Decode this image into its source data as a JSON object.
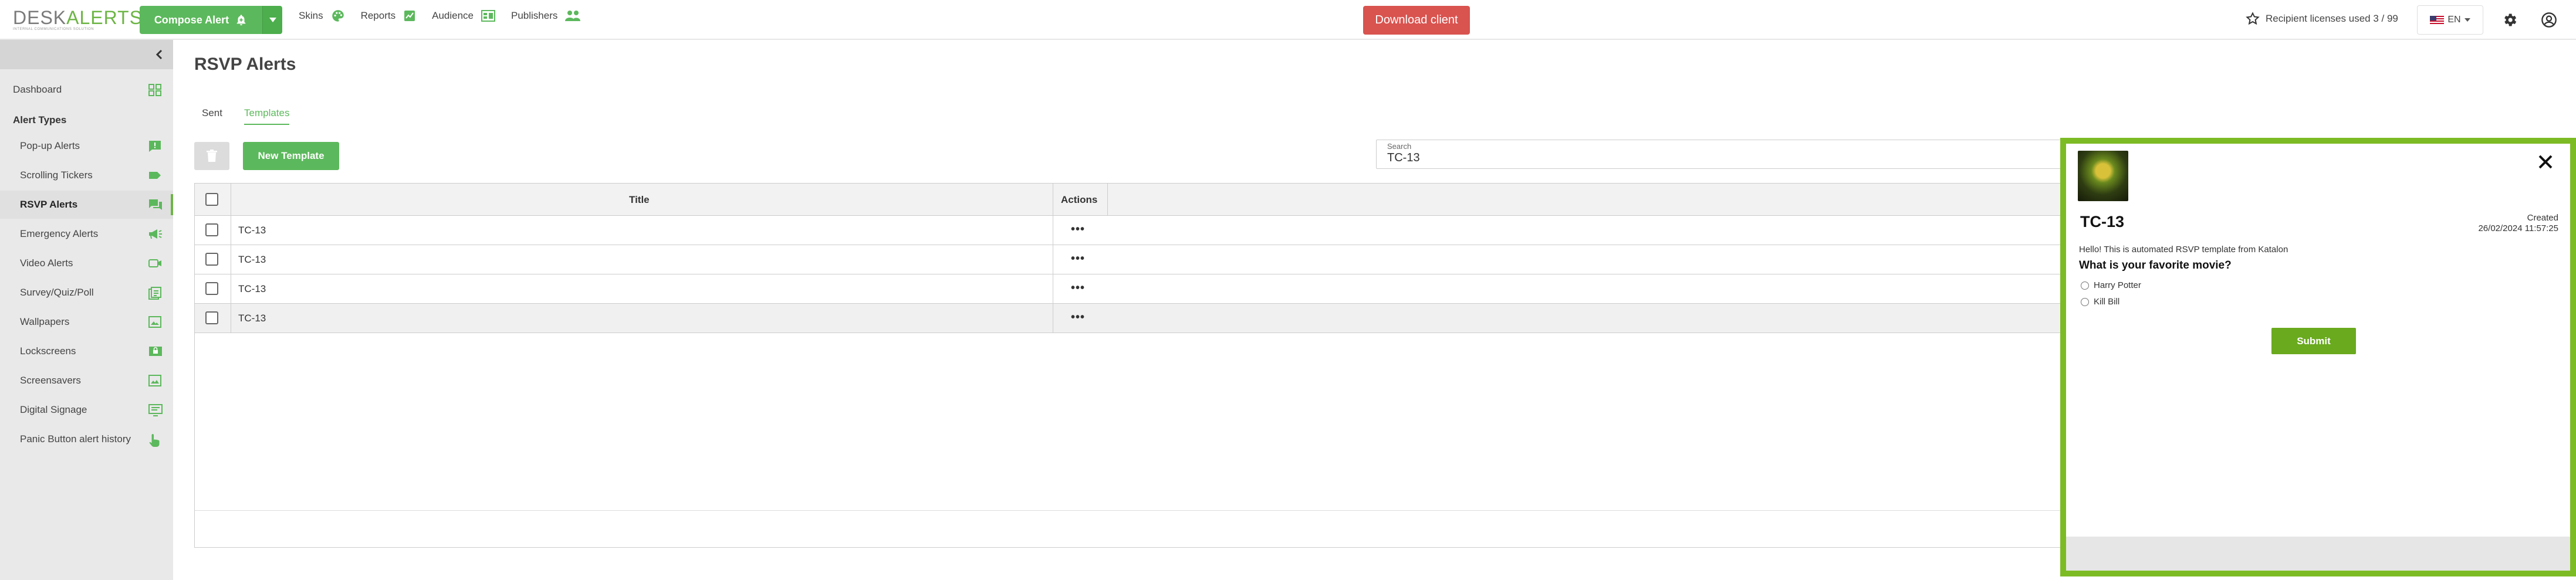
{
  "header": {
    "logo_desk": "DESK",
    "logo_alerts": "ALERTS",
    "logo_tagline": "INTERNAL COMMUNICATIONS SOLUTION",
    "compose_label": "Compose Alert",
    "nav": [
      {
        "label": "Skins",
        "icon": "palette-icon"
      },
      {
        "label": "Reports",
        "icon": "chart-icon"
      },
      {
        "label": "Audience",
        "icon": "org-chart-icon"
      },
      {
        "label": "Publishers",
        "icon": "people-icon"
      }
    ],
    "download_label": "Download client",
    "licenses_text": "Recipient licenses used 3 / 99",
    "language": "EN"
  },
  "sidebar": {
    "dashboard": "Dashboard",
    "section_title": "Alert Types",
    "items": [
      {
        "label": "Pop-up Alerts",
        "icon": "popup-icon"
      },
      {
        "label": "Scrolling Tickers",
        "icon": "ticker-icon"
      },
      {
        "label": "RSVP Alerts",
        "icon": "chat-icon"
      },
      {
        "label": "Emergency Alerts",
        "icon": "megaphone-icon"
      },
      {
        "label": "Video Alerts",
        "icon": "video-icon"
      },
      {
        "label": "Survey/Quiz/Poll",
        "icon": "survey-icon"
      },
      {
        "label": "Wallpapers",
        "icon": "wallpaper-icon"
      },
      {
        "label": "Lockscreens",
        "icon": "lockscreen-icon"
      },
      {
        "label": "Screensavers",
        "icon": "screensaver-icon"
      },
      {
        "label": "Digital Signage",
        "icon": "signage-icon"
      },
      {
        "label": "Panic Button alert history",
        "icon": "hand-pointer-icon"
      }
    ],
    "active_index": 2
  },
  "main": {
    "title": "RSVP Alerts",
    "tabs": [
      "Sent",
      "Templates"
    ],
    "active_tab": 1,
    "new_template_label": "New Template",
    "search": {
      "label": "Search",
      "value": "TC-13"
    },
    "table": {
      "columns": [
        "Title",
        "Actions"
      ],
      "rows": [
        {
          "title": "TC-13",
          "actions": "•••"
        },
        {
          "title": "TC-13",
          "actions": "•••"
        },
        {
          "title": "TC-13",
          "actions": "•••"
        },
        {
          "title": "TC-13",
          "actions": "•••"
        }
      ]
    }
  },
  "preview": {
    "title": "TC-13",
    "created_label": "Created",
    "created_date": "26/02/2024 11:57:25",
    "body": "Hello! This is automated RSVP template from Katalon",
    "question": "What is your favorite movie?",
    "options": [
      "Harry Potter",
      "Kill Bill"
    ],
    "submit_label": "Submit"
  },
  "colors": {
    "brand_green": "#5cb85c",
    "danger_red": "#d9534f",
    "preview_border": "#7dbb24"
  }
}
